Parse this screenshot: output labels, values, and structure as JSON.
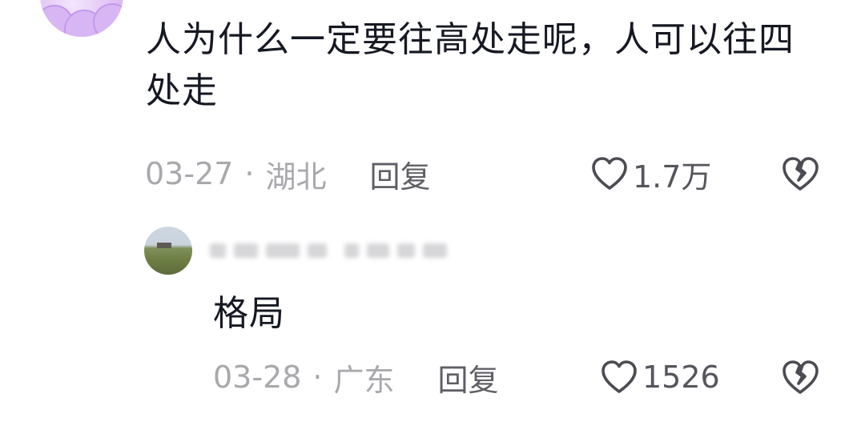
{
  "comment": {
    "text": "人为什么一定要往高处走呢，人可以往四处走",
    "date": "03-27",
    "separator": "·",
    "location": "湖北",
    "reply_label": "回复",
    "like_count": "1.7万",
    "like_icon": "heart-outline-icon",
    "dislike_icon": "broken-heart-icon"
  },
  "reply": {
    "username": "",
    "text": "格局",
    "date": "03-28",
    "separator": "·",
    "location": "广东",
    "reply_label": "回复",
    "like_count": "1526",
    "like_icon": "heart-outline-icon",
    "dislike_icon": "broken-heart-icon"
  },
  "colors": {
    "text_primary": "#161823",
    "text_meta": "#a8a8ad",
    "text_action": "#5f5f66"
  }
}
